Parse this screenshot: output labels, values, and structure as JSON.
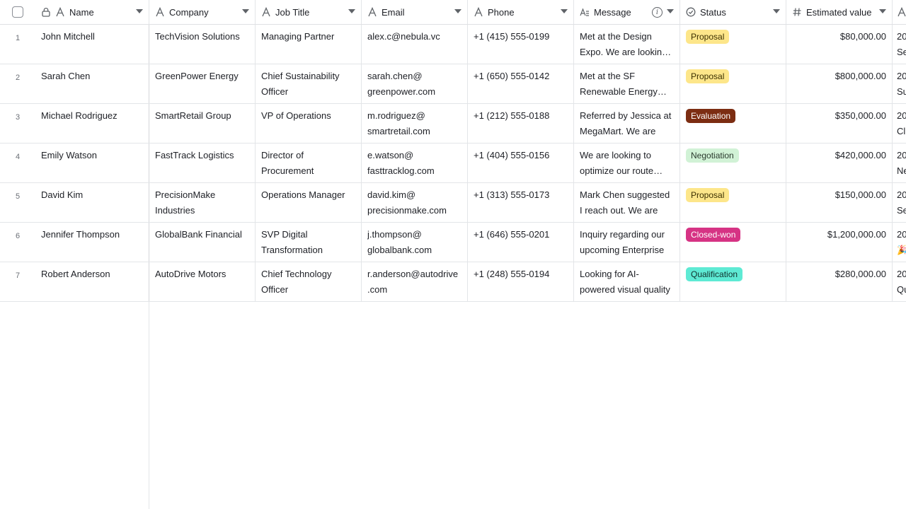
{
  "columns": {
    "name": "Name",
    "company": "Company",
    "job_title": "Job Title",
    "email": "Email",
    "phone": "Phone",
    "message": "Message",
    "status": "Status",
    "estimated_value": "Estimated value"
  },
  "icons": {
    "select_all": "checkbox-icon",
    "lock": "lock-icon",
    "text_field": "text-field-icon",
    "long_text": "long-text-icon",
    "status": "status-icon",
    "number": "hash-icon",
    "info": "info-icon",
    "dropdown": "chevron-down-icon"
  },
  "status_colors": {
    "Proposal": {
      "bg": "#fde68a",
      "fg": "#3b2f00"
    },
    "Evaluation": {
      "bg": "#7c2d12",
      "fg": "#ffffff"
    },
    "Negotiation": {
      "bg": "#d1f2d6",
      "fg": "#2b3a2e"
    },
    "Closed-won": {
      "bg": "#d63384",
      "fg": "#ffffff"
    },
    "Qualification": {
      "bg": "#5eead4",
      "fg": "#10302c"
    }
  },
  "rows": [
    {
      "num": "1",
      "name": "John Mitchell",
      "company": "TechVision Solutions",
      "job_title": "Managing Partner",
      "email": "alex.c@nebula.vc",
      "phone": "+1 (415) 555-0199",
      "message": "Met at the Design Expo. We are looking to",
      "status": "Proposal",
      "value": "$80,000.00",
      "next": "20\nSe"
    },
    {
      "num": "2",
      "name": "Sarah Chen",
      "company": "GreenPower Energy",
      "job_title": "Chief Sustainability Officer",
      "email": "sarah.chen@ greenpower.com",
      "phone": "+1 (650) 555-0142",
      "message": "Met at the SF Renewable Energy Summit",
      "status": "Proposal",
      "value": "$800,000.00",
      "next": "20\nSu"
    },
    {
      "num": "3",
      "name": "Michael Rodriguez",
      "company": "SmartRetail Group",
      "job_title": "VP of Operations",
      "email": "m.rodriguez@ smartretail.com",
      "phone": "+1 (212) 555-0188",
      "message": "Referred by Jessica at MegaMart. We are",
      "status": "Evaluation",
      "value": "$350,000.00",
      "next": "20\nCl"
    },
    {
      "num": "4",
      "name": "Emily Watson",
      "company": "FastTrack Logistics",
      "job_title": "Director of Procurement",
      "email": "e.watson@ fasttracklog.com",
      "phone": "+1 (404) 555-0156",
      "message": "We are looking to optimize our route planning",
      "status": "Negotiation",
      "value": "$420,000.00",
      "next": "20\nNe"
    },
    {
      "num": "5",
      "name": "David Kim",
      "company": "PrecisionMake Industries",
      "job_title": "Operations Manager",
      "email": "david.kim@ precisionmake.com",
      "phone": "+1 (313) 555-0173",
      "message": "Mark Chen suggested  I reach out. We are",
      "status": "Proposal",
      "value": "$150,000.00",
      "next": "20\nSe"
    },
    {
      "num": "6",
      "name": "Jennifer Thompson",
      "company": "GlobalBank Financial",
      "job_title": "SVP Digital Transformation",
      "email": "j.thompson@ globalbank.com",
      "phone": "+1 (646) 555-0201",
      "message": "Inquiry regarding our upcoming Enterprise",
      "status": "Closed-won",
      "value": "$1,200,000.00",
      "next": "20\n🎉"
    },
    {
      "num": "7",
      "name": "Robert Anderson",
      "company": "AutoDrive Motors",
      "job_title": "Chief Technology Officer",
      "email": "r.anderson@autodrive .com",
      "phone": "+1 (248) 555-0194",
      "message": "Looking for AI-powered visual quality",
      "status": "Qualification",
      "value": "$280,000.00",
      "next": "20\nQu"
    }
  ]
}
